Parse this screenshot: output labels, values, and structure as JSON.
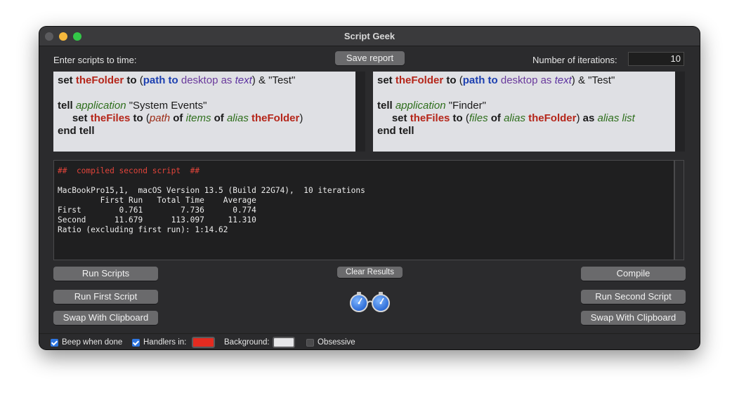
{
  "window": {
    "title": "Script Geek"
  },
  "header": {
    "scripts_label": "Enter scripts to time:",
    "save_report": "Save report",
    "iterations_label": "Number of iterations:",
    "iterations_value": "10"
  },
  "output": {
    "header": "##  compiled second script  ##",
    "lines": [
      "MacBookPro15,1,  macOS Version 13.5 (Build 22G74),  10 iterations",
      "         First Run   Total Time    Average",
      "First        0.761        7.736      0.774",
      "Second      11.679      113.097     11.310",
      "Ratio (excluding first run): 1:14.62"
    ]
  },
  "buttons": {
    "run_scripts": "Run Scripts",
    "clear_results": "Clear Results",
    "compile": "Compile",
    "run_first": "Run First Script",
    "run_second": "Run Second Script",
    "swap_left": "Swap With Clipboard",
    "swap_right": "Swap With Clipboard"
  },
  "bottom": {
    "beep": "Beep when done",
    "handlers": "Handlers in:",
    "background": "Background:",
    "obsessive": "Obsessive",
    "beep_checked": true,
    "handlers_checked": true,
    "obsessive_checked": false,
    "handlers_color": "#e32b20",
    "background_color": "#e6e6e8"
  }
}
